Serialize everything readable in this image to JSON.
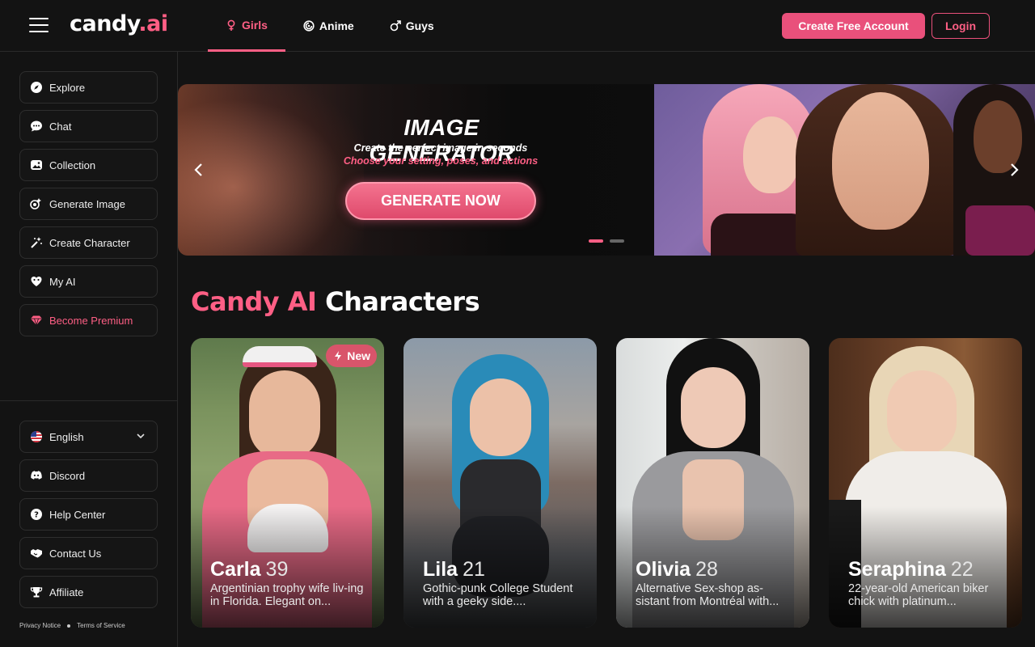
{
  "header": {
    "logo_main": "candy",
    "logo_accent": ".ai",
    "tabs": [
      {
        "label": "Girls",
        "icon": "female-icon",
        "active": true
      },
      {
        "label": "Anime",
        "icon": "anime-icon",
        "active": false
      },
      {
        "label": "Guys",
        "icon": "male-icon",
        "active": false
      }
    ],
    "create_account_label": "Create Free Account",
    "login_label": "Login"
  },
  "sidebar": {
    "items": [
      {
        "label": "Explore",
        "icon": "compass-icon"
      },
      {
        "label": "Chat",
        "icon": "chat-icon"
      },
      {
        "label": "Collection",
        "icon": "gallery-icon"
      },
      {
        "label": "Generate Image",
        "icon": "generate-image-icon"
      },
      {
        "label": "Create Character",
        "icon": "magic-wand-icon"
      },
      {
        "label": "My AI",
        "icon": "heart-mask-icon"
      },
      {
        "label": "Become Premium",
        "icon": "diamond-icon"
      }
    ],
    "bottom_items": [
      {
        "label": "English",
        "icon": "us-flag-icon"
      },
      {
        "label": "Discord",
        "icon": "discord-icon"
      },
      {
        "label": "Help Center",
        "icon": "help-icon"
      },
      {
        "label": "Contact Us",
        "icon": "handshake-icon"
      },
      {
        "label": "Affiliate",
        "icon": "trophy-icon"
      }
    ],
    "privacy_label": "Privacy Notice",
    "terms_label": "Terms of Service"
  },
  "banner": {
    "title": "IMAGE GENERATOR",
    "subtitle": "Create the perfect image in seconds",
    "subtitle2": "Choose your setting, poses, and actions",
    "button_label": "GENERATE NOW",
    "active_slide": 1,
    "slide_count": 2
  },
  "section": {
    "title_accent": "Candy AI",
    "title_rest": "Characters"
  },
  "cards": [
    {
      "name": "Carla",
      "age": "39",
      "desc": "Argentinian trophy wife liv-ing in Florida. Elegant on...",
      "badge": "New"
    },
    {
      "name": "Lila",
      "age": "21",
      "desc": "Gothic-punk College Student with a geeky side....",
      "badge": ""
    },
    {
      "name": "Olivia",
      "age": "28",
      "desc": "Alternative Sex-shop as-sistant from Montréal with...",
      "badge": ""
    },
    {
      "name": "Seraphina",
      "age": "22",
      "desc": "22-year-old American biker chick with platinum...",
      "badge": ""
    }
  ],
  "colors": {
    "accent": "#ff5f85",
    "button": "#e9507b",
    "background": "#131313"
  }
}
